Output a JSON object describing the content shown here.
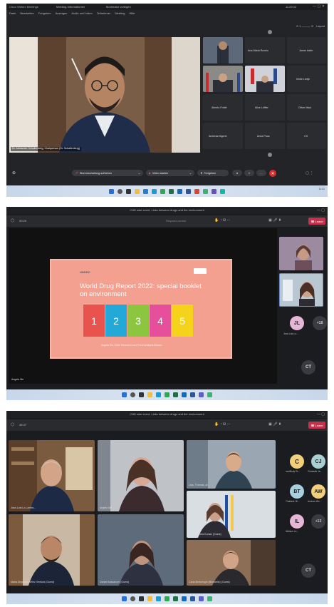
{
  "shot1": {
    "title_tab1": "Cisco Webex Meetings",
    "title_tab2": "Meeting-Informationen",
    "title_tab3": "Moderator vorlegen",
    "menu": [
      "Datei",
      "Bearbeiten",
      "Freigeben",
      "Anzeigen",
      "Audio und Video",
      "Teilnehmer",
      "Meeting",
      "Hilfe"
    ],
    "clock": "11:20:12",
    "layout_label": "Layout",
    "speaker_label": "Dr. Alexander Schallenberg, Chairperson (Dr. Schallenberg)",
    "participants": [
      {
        "name": "Ana-Maria Ruxelu"
      },
      {
        "name": "Janne Ickler"
      },
      {
        "name": "Irelde Lörtje"
      },
      {
        "name": "Alberto Fridel"
      },
      {
        "name": "Alice Löffler"
      },
      {
        "name": "Oliver Maul"
      },
      {
        "name": "Andreas Bigerin"
      },
      {
        "name": "Anna Paus"
      },
      {
        "name": "CS"
      }
    ],
    "controls": {
      "mute": "Stummschaltung aufheben",
      "video": "Video starten",
      "share": "Freigeben"
    },
    "tray_time": "11:21"
  },
  "shot2": {
    "window_title": "CND side event, Links between drugs and the environment",
    "timer": "00:29",
    "request_control": "Request control",
    "leave": "Leave",
    "slide": {
      "org": "UNODC",
      "title": "World Drug Report 2022: special booklet on environment",
      "booklets": [
        "1",
        "2",
        "3",
        "4",
        "5"
      ],
      "footer": "Angela Me, Chief Research and Trend Analysis Branch"
    },
    "presenter": "Angela Me",
    "avatars": [
      {
        "initials": "JL",
        "name": "Jose-Luis Lo..."
      },
      {
        "initials": "+18",
        "name": ""
      },
      {
        "initials": "CT",
        "name": ""
      }
    ],
    "colors": {
      "leave": "#c4314b",
      "slide_bg": "#f4a090"
    }
  },
  "shot3": {
    "window_title": "CND side event, Links between drugs and the environment",
    "timer": "48:37",
    "leave": "Leave",
    "tiles": [
      {
        "name": "Jose-Luis Lo Lombo..."
      },
      {
        "name": "Angela Me"
      },
      {
        "name": "Lisa, Thomas, dr..."
      },
      {
        "name": "Dr. Chirantha Kumar (Guest)"
      },
      {
        "name": "Maria Alejandra Velez Ventura (Guest)"
      },
      {
        "name": "Daniel Bassarumi (Guest)"
      },
      {
        "name": "Carla Bertolinghi (Biondello) (Guest)"
      }
    ],
    "avatars": [
      {
        "initials": "C",
        "name": "cestBody Gr...",
        "color": "#f2cf7a"
      },
      {
        "initials": "CJ",
        "name": "Christelle Ja...",
        "color": "#a8d0d2"
      },
      {
        "initials": "BT",
        "name": "Thailand, Bi...",
        "color": "#a8cfe0"
      },
      {
        "initials": "AW",
        "name": "Andrew Wo...",
        "color": "#f2cf7a"
      },
      {
        "initials": "IL",
        "name": "Ildidium Le...",
        "color": "#e5b6d6"
      },
      {
        "initials": "+13",
        "name": "",
        "color": "#3a3b40"
      },
      {
        "initials": "CT",
        "name": "",
        "color": "#3a3b40"
      }
    ]
  }
}
